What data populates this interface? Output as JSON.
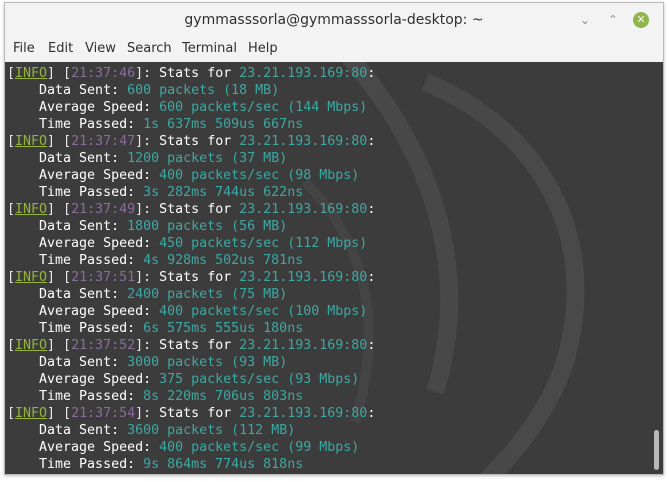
{
  "window": {
    "title": "gymmasssorla@gymmasssorla-desktop: ~",
    "minimize_glyph": "⌄",
    "maximize_glyph": "⌃",
    "close_glyph": "✕"
  },
  "menu": [
    "File",
    "Edit",
    "View",
    "Search",
    "Terminal",
    "Help"
  ],
  "terminal": {
    "blocks": [
      {
        "level": "INFO",
        "time": "21:37:46",
        "stats": "Stats for ",
        "ip": "23.21.193.169:80",
        "data_sent": "600 packets (18 MB)",
        "avg_speed": "600 packets/sec (144 Mbps)",
        "time_passed": "1s 637ms 509us 667ns"
      },
      {
        "level": "INFO",
        "time": "21:37:47",
        "stats": "Stats for ",
        "ip": "23.21.193.169:80",
        "data_sent": "1200 packets (37 MB)",
        "avg_speed": "400 packets/sec (98 Mbps)",
        "time_passed": "3s 282ms 744us 622ns"
      },
      {
        "level": "INFO",
        "time": "21:37:49",
        "stats": "Stats for ",
        "ip": "23.21.193.169:80",
        "data_sent": "1800 packets (56 MB)",
        "avg_speed": "450 packets/sec (112 Mbps)",
        "time_passed": "4s 928ms 502us 781ns"
      },
      {
        "level": "INFO",
        "time": "21:37:51",
        "stats": "Stats for ",
        "ip": "23.21.193.169:80",
        "data_sent": "2400 packets (75 MB)",
        "avg_speed": "400 packets/sec (100 Mbps)",
        "time_passed": "6s 575ms 555us 180ns"
      },
      {
        "level": "INFO",
        "time": "21:37:52",
        "stats": "Stats for ",
        "ip": "23.21.193.169:80",
        "data_sent": "3000 packets (93 MB)",
        "avg_speed": "375 packets/sec (93 Mbps)",
        "time_passed": "8s 220ms 706us 803ns"
      },
      {
        "level": "INFO",
        "time": "21:37:54",
        "stats": "Stats for ",
        "ip": "23.21.193.169:80",
        "data_sent": "3600 packets (112 MB)",
        "avg_speed": "400 packets/sec (99 Mbps)",
        "time_passed": "9s 864ms 774us 818ns"
      }
    ],
    "labels": {
      "data_sent": "    Data Sent: ",
      "avg_speed": "    Average Speed: ",
      "time_passed": "    Time Passed: "
    }
  },
  "colors": {
    "terminal_bg": "#3c3c3c",
    "level": "#95b536",
    "timestamp": "#8b6b9e",
    "value": "#3ba9a3",
    "close_button": "#8fb54b"
  }
}
